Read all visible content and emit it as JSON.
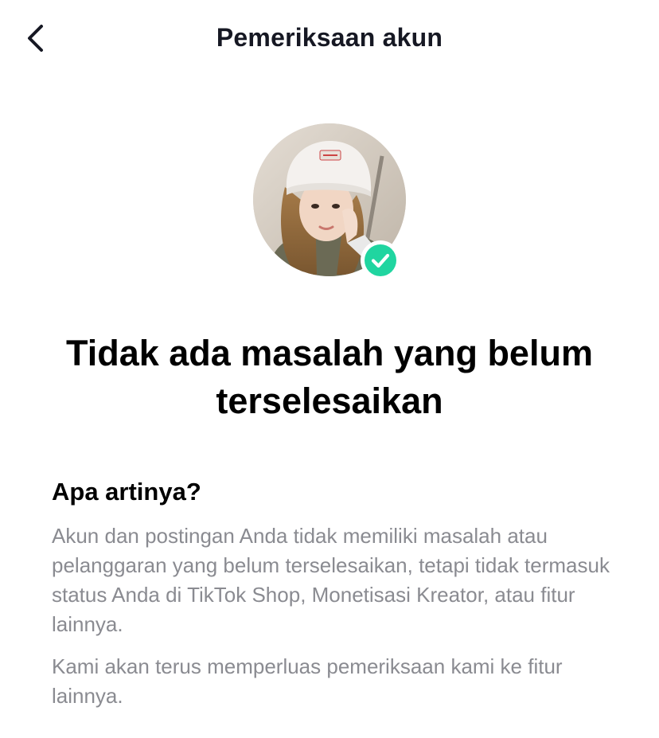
{
  "header": {
    "back_icon": "chevron-left-icon",
    "title": "Pemeriksaan akun"
  },
  "profile": {
    "avatar_alt": "profile photo",
    "badge_icon": "check-circle-icon",
    "badge_color": "#20D5A0"
  },
  "status": {
    "heading": "Tidak ada masalah yang belum terselesaikan"
  },
  "explanation": {
    "title": "Apa artinya?",
    "paragraph_1": "Akun dan postingan Anda tidak memiliki masalah atau pelanggaran yang belum terselesaikan, tetapi tidak termasuk status Anda di TikTok Shop, Monetisasi Kreator, atau fitur lainnya.",
    "paragraph_2": "Kami akan terus memperluas pemeriksaan kami ke fitur lainnya."
  },
  "colors": {
    "text_primary": "#161823",
    "text_secondary": "#8A8B91",
    "success": "#20D5A0"
  }
}
